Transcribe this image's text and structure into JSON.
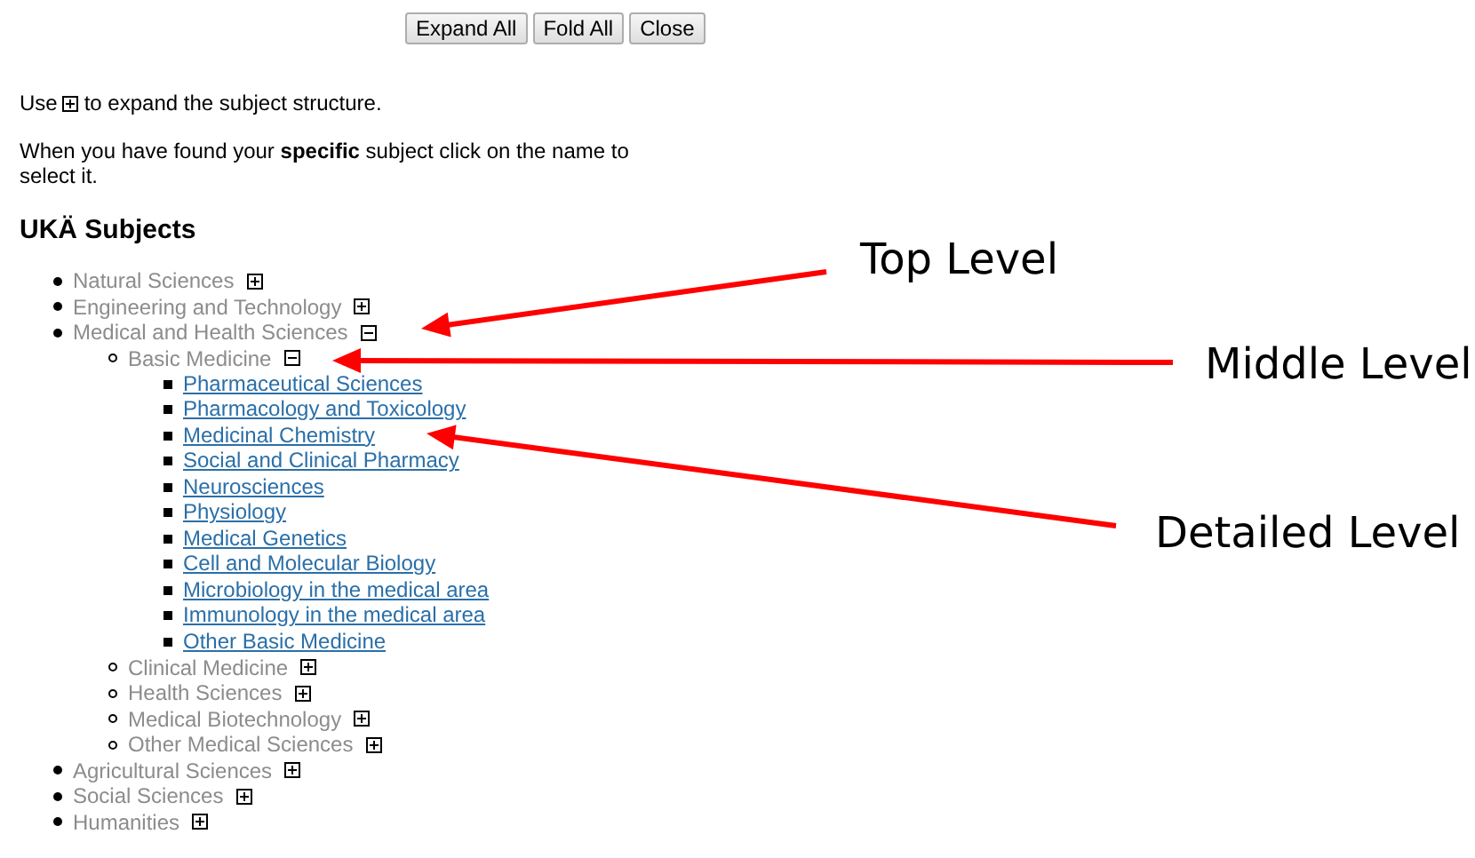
{
  "toolbar": {
    "buttons": [
      "Expand All",
      "Fold All",
      "Close"
    ]
  },
  "intro": {
    "before": "Use",
    "after": "to expand the subject structure.",
    "instruction": "When you have found your **specific** subject click on the name to select it."
  },
  "heading": "UKÄ Subjects",
  "tree": [
    {
      "label": "Natural Sciences",
      "kind": "group",
      "expanded": false
    },
    {
      "label": "Engineering and Technology",
      "kind": "group",
      "expanded": false
    },
    {
      "label": "Medical and Health Sciences",
      "kind": "group",
      "expanded": true,
      "children": [
        {
          "label": "Basic Medicine",
          "kind": "group",
          "expanded": true,
          "children": [
            {
              "label": "Pharmaceutical Sciences",
              "kind": "link"
            },
            {
              "label": "Pharmacology and Toxicology",
              "kind": "link"
            },
            {
              "label": "Medicinal Chemistry",
              "kind": "link"
            },
            {
              "label": "Social and Clinical Pharmacy",
              "kind": "link"
            },
            {
              "label": "Neurosciences",
              "kind": "link"
            },
            {
              "label": "Physiology",
              "kind": "link"
            },
            {
              "label": "Medical Genetics",
              "kind": "link"
            },
            {
              "label": "Cell and Molecular Biology",
              "kind": "link"
            },
            {
              "label": "Microbiology in the medical area",
              "kind": "link"
            },
            {
              "label": "Immunology in the medical area",
              "kind": "link"
            },
            {
              "label": "Other Basic Medicine",
              "kind": "link"
            }
          ]
        },
        {
          "label": "Clinical Medicine",
          "kind": "group",
          "expanded": false
        },
        {
          "label": "Health Sciences",
          "kind": "group",
          "expanded": false
        },
        {
          "label": "Medical Biotechnology",
          "kind": "group",
          "expanded": false
        },
        {
          "label": "Other Medical Sciences",
          "kind": "group",
          "expanded": false
        }
      ]
    },
    {
      "label": "Agricultural Sciences",
      "kind": "group",
      "expanded": false
    },
    {
      "label": "Social Sciences",
      "kind": "group",
      "expanded": false
    },
    {
      "label": "Humanities",
      "kind": "group",
      "expanded": false
    }
  ],
  "annotations": [
    {
      "text": "Top Level"
    },
    {
      "text": "Middle Level"
    },
    {
      "text": "Detailed Level"
    }
  ]
}
